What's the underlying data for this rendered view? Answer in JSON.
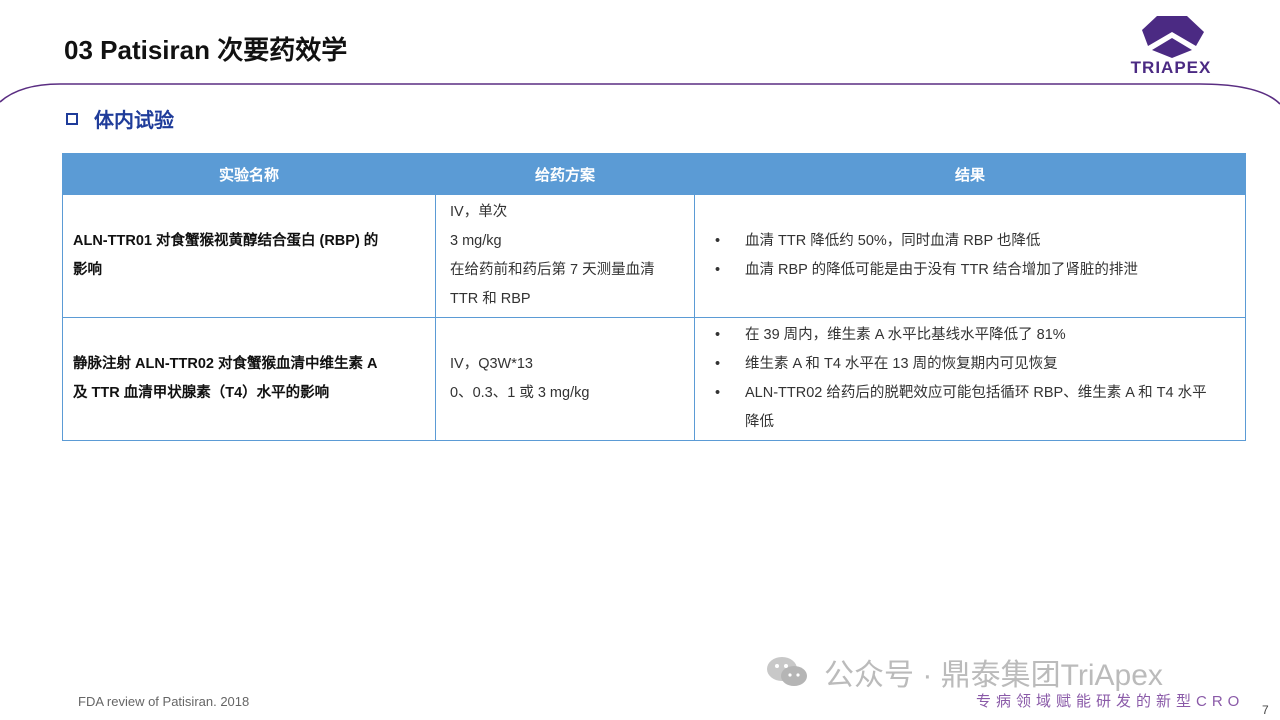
{
  "header": {
    "title": "03 Patisiran 次要药效学",
    "logo_text": "TRIAPEX"
  },
  "section": {
    "title": "体内试验"
  },
  "table": {
    "headers": [
      "实验名称",
      "给药方案",
      "结果"
    ],
    "rows": [
      {
        "name": [
          "ALN-TTR01 对食蟹猴视黄醇结合蛋白 (RBP) 的",
          "影响"
        ],
        "dosing": [
          "IV，单次",
          "3 mg/kg",
          "在给药前和药后第 7 天测量血清",
          "TTR 和 RBP"
        ],
        "results": [
          "血清 TTR 降低约 50%，同时血清 RBP 也降低",
          "血清 RBP 的降低可能是由于没有 TTR 结合增加了肾脏的排泄"
        ]
      },
      {
        "name": [
          "静脉注射 ALN-TTR02 对食蟹猴血清中维生素 A",
          "及 TTR 血清甲状腺素（T4）水平的影响"
        ],
        "dosing": [
          "IV，Q3W*13",
          "0、0.3、1 或 3 mg/kg"
        ],
        "results": [
          "在 39 周内，维生素 A 水平比基线水平降低了 81%",
          "维生素 A 和 T4 水平在 13 周的恢复期内可见恢复",
          "ALN-TTR02 给药后的脱靶效应可能包括循环 RBP、维生素 A 和 T4 水平",
          "降低"
        ]
      }
    ]
  },
  "footer": {
    "reference": "FDA review of Patisiran. 2018",
    "watermark": "公众号 · 鼎泰集团TriApex",
    "tagline": "专病领域赋能研发的新型CRO",
    "page_number": "7"
  },
  "colors": {
    "accent": "#4b2a83",
    "table_header": "#5b9bd5",
    "section": "#1f3c9a"
  }
}
